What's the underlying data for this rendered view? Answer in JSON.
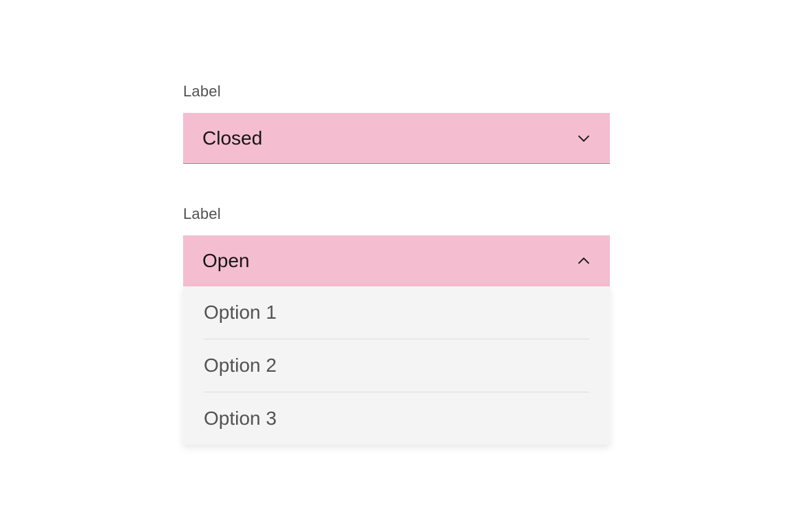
{
  "dropdown_closed": {
    "label": "Label",
    "value": "Closed"
  },
  "dropdown_open": {
    "label": "Label",
    "value": "Open",
    "options": [
      "Option 1",
      "Option 2",
      "Option 3"
    ]
  },
  "colors": {
    "accent_bg": "#f4bed0",
    "panel_bg": "#f4f4f4",
    "text_primary": "#161616",
    "text_secondary": "#525252",
    "divider": "#dcdcdc",
    "underline": "#8d8d8d"
  }
}
